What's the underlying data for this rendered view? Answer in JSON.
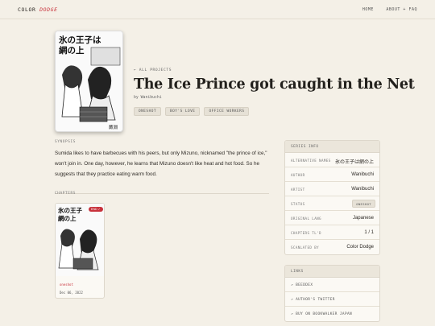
{
  "nav": {
    "brand_main": "COLOR",
    "brand_accent": "DODGE",
    "home": "HOME",
    "about": "ABOUT + FAQ"
  },
  "cover": {
    "title_jp": "氷の王子は網の上",
    "author_mark": "蕨淵"
  },
  "header": {
    "back": "← ALL PROJECTS",
    "title": "The Ice Prince got caught in the Net",
    "byline": "by Wanibuchi",
    "tags": [
      "ONESHOT",
      "BOY'S LOVE",
      "OFFICE WORKERS"
    ]
  },
  "synopsis": {
    "label": "SYNOPSIS",
    "text": "Sumida likes to have barbecues with his peers, but only Mizuno, nicknamed \"the prince of ice,\" won't join in. One day, however, he learns that Mizuno doesn't like heat and hot food. So he suggests that they practice eating warm food."
  },
  "chapters": {
    "label": "CHAPTERS",
    "items": [
      {
        "badge": "END ✓",
        "name": "oneshot",
        "date": "Dec 06, 2022"
      }
    ]
  },
  "series_info": {
    "header": "SERIES INFO",
    "rows": [
      {
        "key": "ALTERNATIVE NAMES",
        "value": "氷の王子は網の上"
      },
      {
        "key": "AUTHOR",
        "value": "Wanibuchi"
      },
      {
        "key": "ARTIST",
        "value": "Wanibuchi"
      },
      {
        "key": "STATUS",
        "value": "ONESHOT"
      },
      {
        "key": "ORIGINAL LANG",
        "value": "Japanese"
      },
      {
        "key": "CHAPTERS TL'D",
        "value": "1 / 1"
      },
      {
        "key": "SCANLATED BY",
        "value": "Color Dodge"
      }
    ]
  },
  "links": {
    "header": "LINKS",
    "items": [
      "↗ BEEDDEX",
      "↗ AUTHOR'S TWITTER",
      "↗ BUY ON BOOKWALKER JAPAN"
    ]
  },
  "colors": {
    "background": "#f4f0e7",
    "accent": "#c8323c",
    "panel": "#fbf9f4"
  }
}
